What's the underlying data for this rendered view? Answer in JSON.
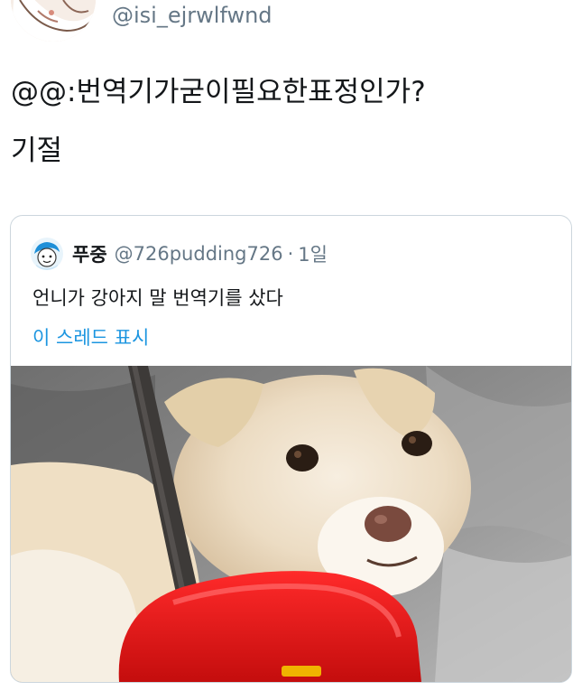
{
  "tweet": {
    "handle": "@isi_ejrwlfwnd",
    "text_lines": [
      "@@:번역기가굳이필요한표정인가?",
      "기절"
    ]
  },
  "quoted_tweet": {
    "display_name": "푸중",
    "handle": "@726pudding726",
    "separator": "·",
    "time": "1일",
    "text": "언니가 강아지 말 번역기를 샀다",
    "show_thread_label": "이 스레드 표시",
    "colors": {
      "link": "#1b95e0",
      "muted": "#657786",
      "border": "#ccd6dd"
    }
  },
  "icons": {
    "user_avatar": "avatar-image",
    "quoted_avatar": "quoted-avatar-image",
    "photo": "dog-translator-photo"
  }
}
